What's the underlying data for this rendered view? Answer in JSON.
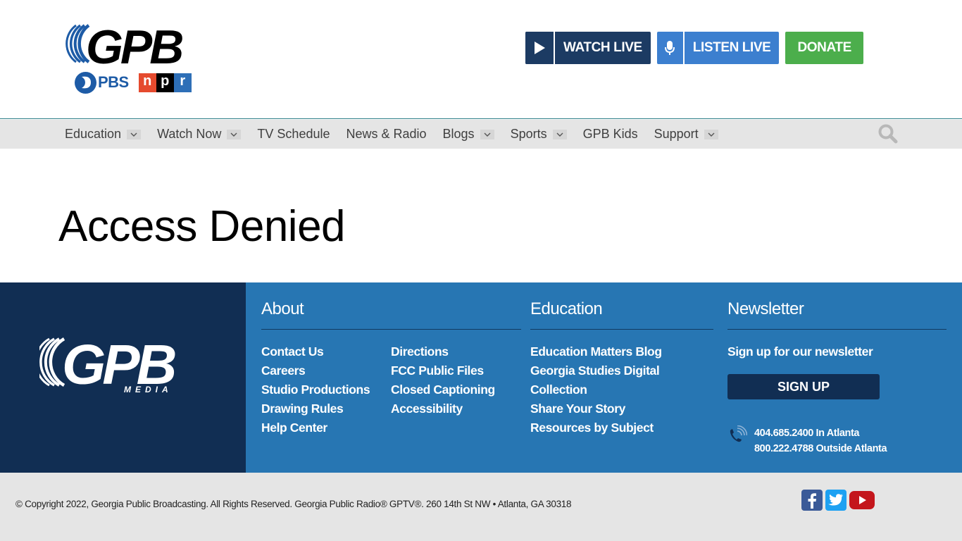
{
  "brand": {
    "logo_text": "GPB",
    "pbs_text": "PBS",
    "npr_letters": [
      "n",
      "p",
      "r"
    ],
    "footer_logo_text": "GPB",
    "footer_logo_sub": "MEDIA"
  },
  "header": {
    "watch_live": "WATCH LIVE",
    "listen_live": "LISTEN LIVE",
    "donate": "DONATE"
  },
  "nav": {
    "items": [
      {
        "label": "Education",
        "has_dropdown": true
      },
      {
        "label": "Watch Now",
        "has_dropdown": true
      },
      {
        "label": "TV Schedule",
        "has_dropdown": false
      },
      {
        "label": "News & Radio",
        "has_dropdown": false
      },
      {
        "label": "Blogs",
        "has_dropdown": true
      },
      {
        "label": "Sports",
        "has_dropdown": true
      },
      {
        "label": "GPB Kids",
        "has_dropdown": false
      },
      {
        "label": "Support",
        "has_dropdown": true
      }
    ]
  },
  "main": {
    "title": "Access Denied"
  },
  "footer": {
    "about": {
      "heading": "About",
      "links_left": [
        "Contact Us",
        "Careers",
        "Studio Productions",
        "Drawing Rules",
        "Help Center"
      ],
      "links_right": [
        "Directions",
        "FCC Public Files",
        "Closed Captioning",
        "Accessibility"
      ]
    },
    "education": {
      "heading": "Education",
      "links": [
        "Education Matters Blog",
        "Georgia Studies Digital",
        "Collection",
        "Share Your Story",
        "Resources by Subject"
      ]
    },
    "newsletter": {
      "heading": "Newsletter",
      "text": "Sign up for our newsletter",
      "signup": "SIGN UP",
      "phone_atlanta": "404.685.2400 In Atlanta",
      "phone_outside": "800.222.4788 Outside Atlanta"
    }
  },
  "bottom": {
    "copyright": "© Copyright 2022, Georgia Public Broadcasting. All Rights Reserved. Georgia Public Radio® GPTV®. 260 14th St NW • Atlanta, GA 30318"
  },
  "colors": {
    "header_navy": "#1c3b63",
    "listen_blue": "#3c7fcf",
    "donate_green": "#4cae4c",
    "footer_blue": "#2776b3",
    "footer_navy": "#112e53",
    "nav_gray": "#e5e5e5"
  }
}
